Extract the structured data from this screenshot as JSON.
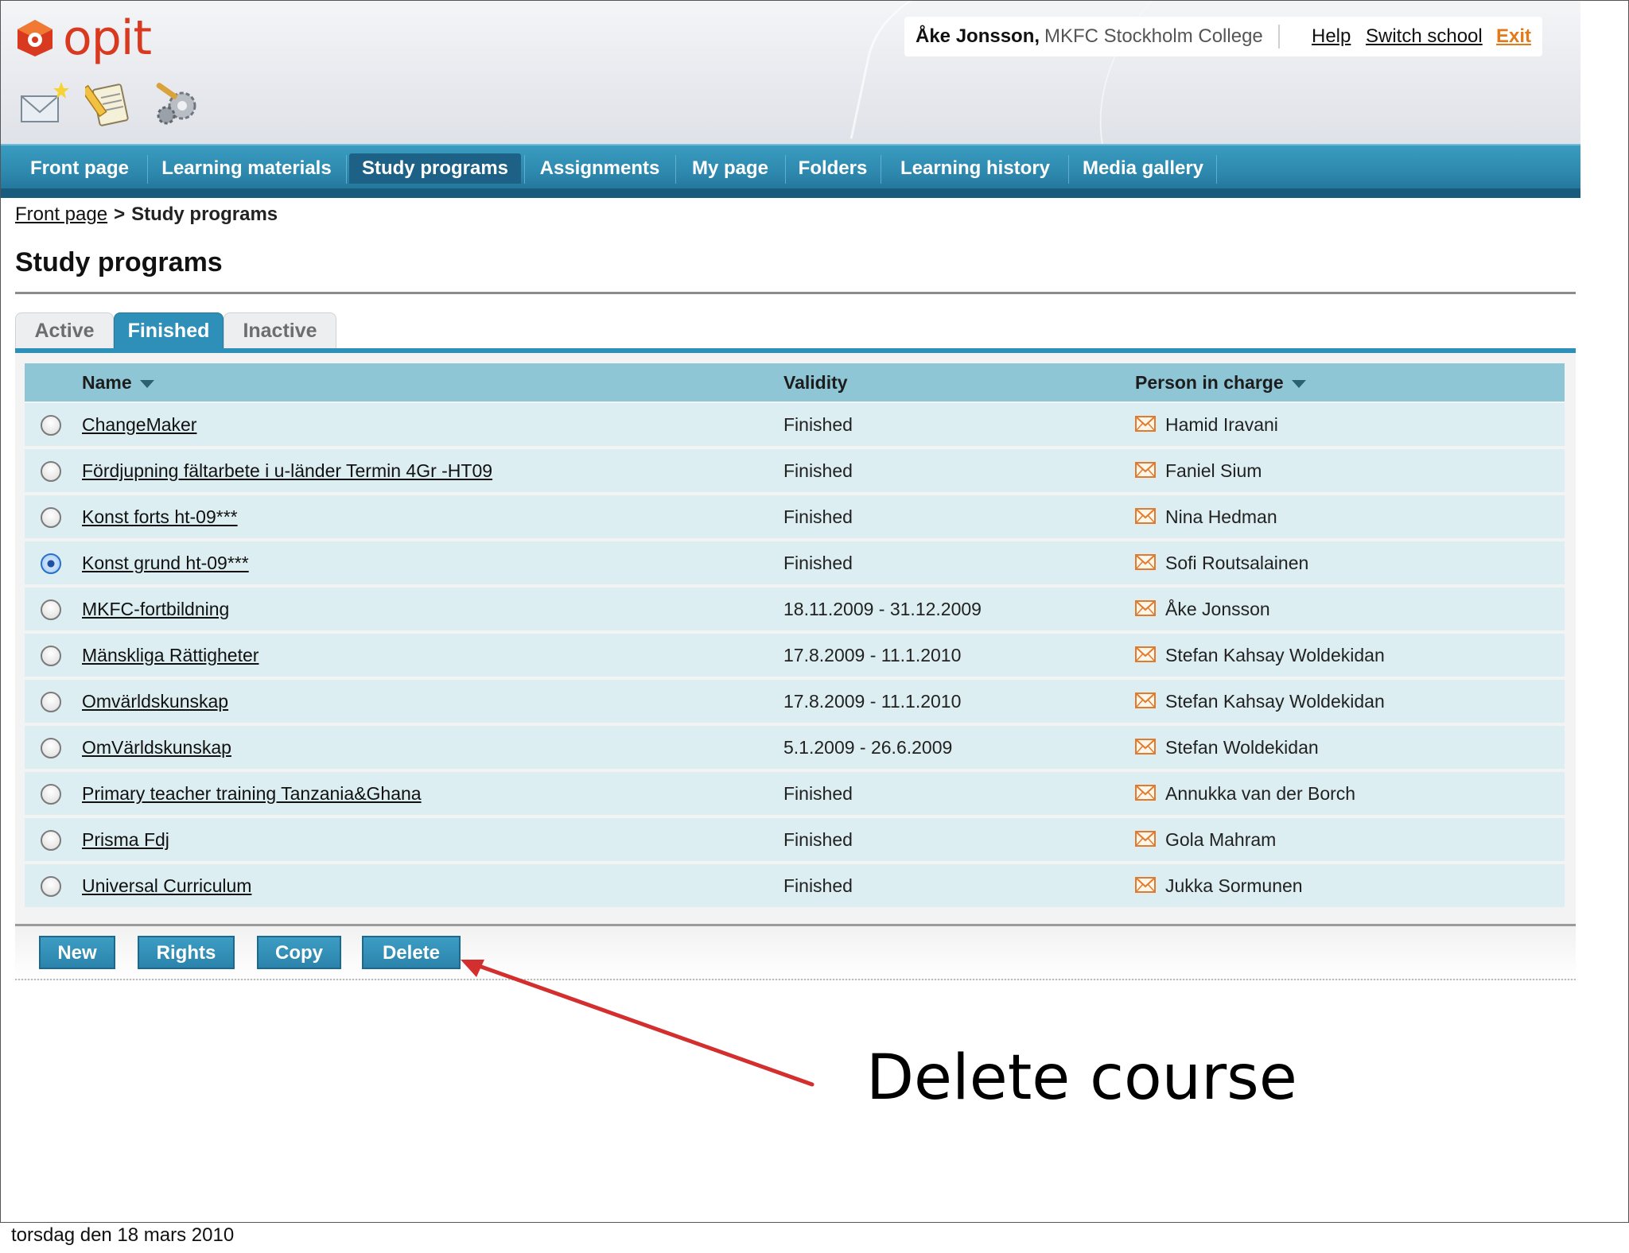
{
  "logo": {
    "text": "opit"
  },
  "toolbar_icons": [
    "new-mail-icon",
    "notes-icon",
    "settings-gears-icon"
  ],
  "user": {
    "name": "Åke Jonsson,",
    "school": "MKFC Stockholm College",
    "help": "Help",
    "switch_school": "Switch school",
    "exit": "Exit"
  },
  "nav": [
    "Front page",
    "Learning materials",
    "Study programs",
    "Assignments",
    "My page",
    "Folders",
    "Learning history",
    "Media gallery"
  ],
  "nav_active": "Study programs",
  "breadcrumb": {
    "home": "Front page",
    "separator": ">",
    "current": "Study programs"
  },
  "page_title": "Study programs",
  "tabs": [
    "Active",
    "Finished",
    "Inactive"
  ],
  "tab_active": "Finished",
  "table": {
    "headers": {
      "name": "Name",
      "validity": "Validity",
      "person": "Person in charge"
    },
    "rows": [
      {
        "name": "ChangeMaker",
        "validity": "Finished",
        "person": "Hamid Iravani",
        "selected": false
      },
      {
        "name": "Fördjupning fältarbete i u-länder Termin 4Gr -HT09",
        "validity": "Finished",
        "person": "Faniel Sium",
        "selected": false
      },
      {
        "name": "Konst forts ht-09***",
        "validity": "Finished",
        "person": "Nina Hedman",
        "selected": false
      },
      {
        "name": "Konst grund ht-09***",
        "validity": "Finished",
        "person": "Sofi Routsalainen",
        "selected": true
      },
      {
        "name": "MKFC-fortbildning",
        "validity": "18.11.2009 - 31.12.2009",
        "person": "Åke Jonsson",
        "selected": false
      },
      {
        "name": "Mänskliga Rättigheter",
        "validity": "17.8.2009 - 11.1.2010",
        "person": "Stefan Kahsay Woldekidan",
        "selected": false
      },
      {
        "name": "Omvärldskunskap",
        "validity": "17.8.2009 - 11.1.2010",
        "person": "Stefan Kahsay Woldekidan",
        "selected": false
      },
      {
        "name": "OmVärldskunskap",
        "validity": "5.1.2009 - 26.6.2009",
        "person": "Stefan Woldekidan",
        "selected": false
      },
      {
        "name": "Primary teacher training Tanzania&Ghana",
        "validity": "Finished",
        "person": "Annukka van der Borch",
        "selected": false
      },
      {
        "name": "Prisma Fdj",
        "validity": "Finished",
        "person": "Gola Mahram",
        "selected": false
      },
      {
        "name": "Universal Curriculum",
        "validity": "Finished",
        "person": "Jukka Sormunen",
        "selected": false
      }
    ]
  },
  "buttons": {
    "new": "New",
    "rights": "Rights",
    "copy": "Copy",
    "delete": "Delete"
  },
  "annotation": "Delete course",
  "footer_date": "torsdag den 18 mars 2010",
  "colors": {
    "nav": "#2d87ad",
    "accent": "#2e8fb8",
    "header_row": "#8fc6d5",
    "row": "#dceef1",
    "exit": "#e37a1a",
    "logo": "#d93a1f",
    "arrow": "#d32f2f"
  }
}
